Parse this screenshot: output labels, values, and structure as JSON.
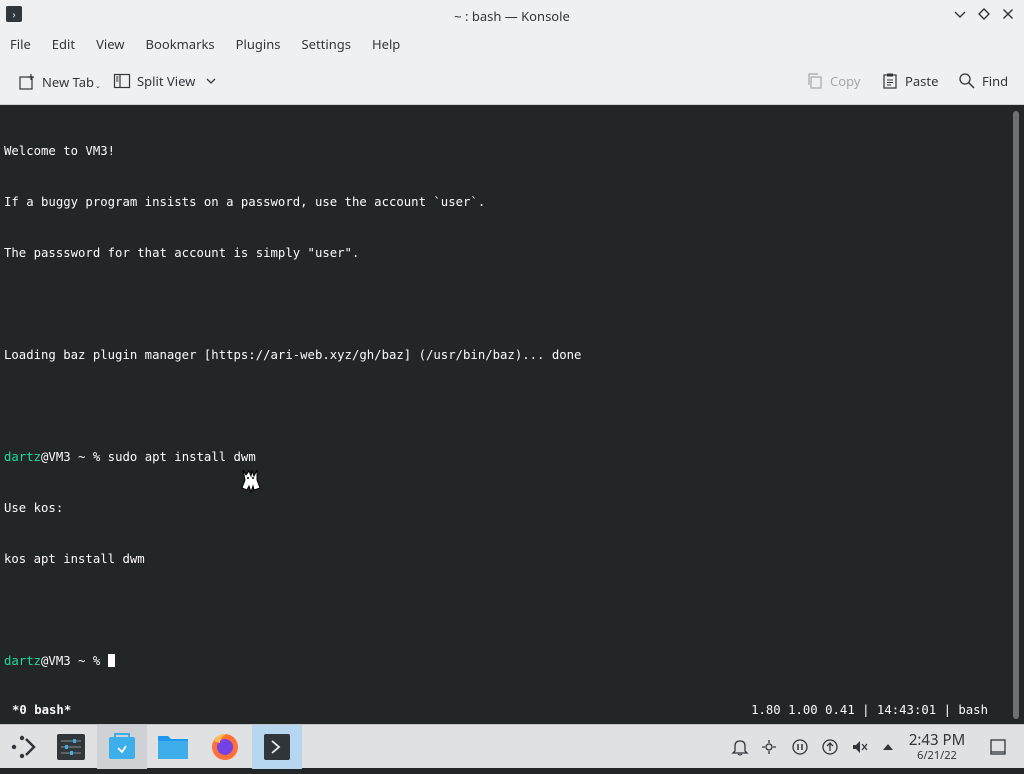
{
  "window": {
    "title": "~ : bash — Konsole",
    "app_icon": "terminal-icon"
  },
  "menubar": {
    "items": [
      "File",
      "Edit",
      "View",
      "Bookmarks",
      "Plugins",
      "Settings",
      "Help"
    ]
  },
  "toolbar": {
    "new_tab": "New Tab",
    "split_view": "Split View",
    "copy": "Copy",
    "paste": "Paste",
    "find": "Find"
  },
  "terminal": {
    "lines": [
      "Welcome to VM3!",
      "If a buggy program insists on a password, use the account `user`.",
      "The passsword for that account is simply \"user\".",
      "",
      "Loading baz plugin manager [https://ari-web.xyz/gh/baz] (/usr/bin/baz)... done",
      ""
    ],
    "prompt1": {
      "user": "dartz",
      "host": "@VM3 ~ % ",
      "command": "sudo apt install dwm"
    },
    "output": [
      "Use kos:",
      "kos apt install dwm",
      ""
    ],
    "prompt2": {
      "user": "dartz",
      "host": "@VM3 ~ % "
    }
  },
  "statusline": {
    "left": "*0 bash*",
    "right": "1.80 1.00 0.41 | 14:43:01 | bash"
  },
  "taskbar": {
    "apps": [
      "app-launcher",
      "system-settings",
      "discover",
      "dolphin-files",
      "firefox",
      "konsole"
    ],
    "clock": {
      "time": "2:43 PM",
      "date": "6/21/22"
    }
  },
  "colors": {
    "terminal_bg": "#232627",
    "prompt_user": "#1cdc9a",
    "chrome_bg": "#eff0f1",
    "taskbar_bg": "#dfe1e3",
    "active_task": "#b6d7ef"
  }
}
